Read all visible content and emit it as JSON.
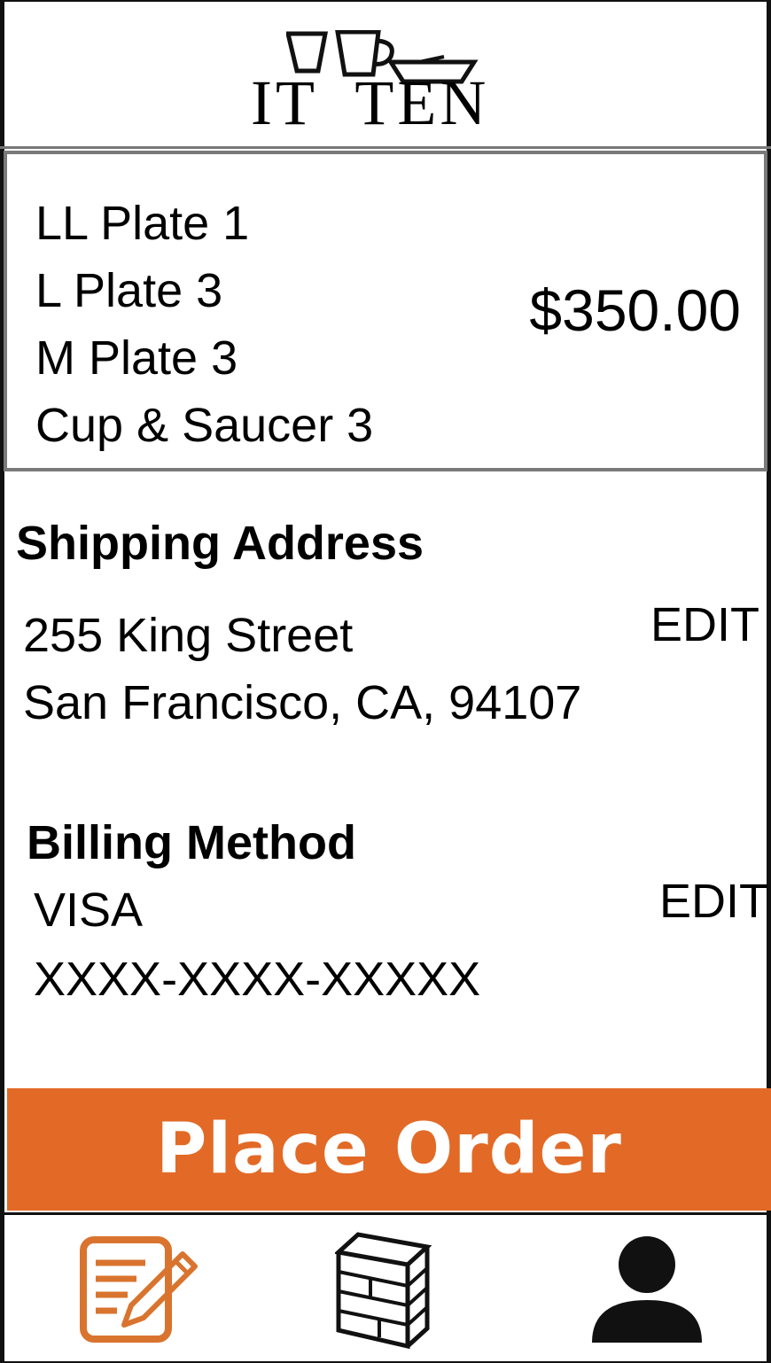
{
  "header": {
    "logo_text": "IT TEN",
    "logo_left": "IT",
    "logo_right": "TEN"
  },
  "order": {
    "items": [
      "LL Plate 1",
      "L Plate 3",
      "M Plate 3",
      "Cup & Saucer 3"
    ],
    "total": "$350.00"
  },
  "shipping": {
    "title": "Shipping Address",
    "line1": "255 King Street",
    "line2": "San Francisco, CA, 94107",
    "edit_label": "EDIT"
  },
  "billing": {
    "title": "Billing Method",
    "card_type": "VISA",
    "card_number": "XXXX-XXXX-XXXXX",
    "edit_label": "EDIT"
  },
  "actions": {
    "place_order_label": "Place Order"
  },
  "colors": {
    "accent": "#e26a26",
    "border": "#7a7a7a"
  },
  "tabs": [
    {
      "icon": "edit-note-icon"
    },
    {
      "icon": "shelf-icon"
    },
    {
      "icon": "user-icon"
    }
  ]
}
